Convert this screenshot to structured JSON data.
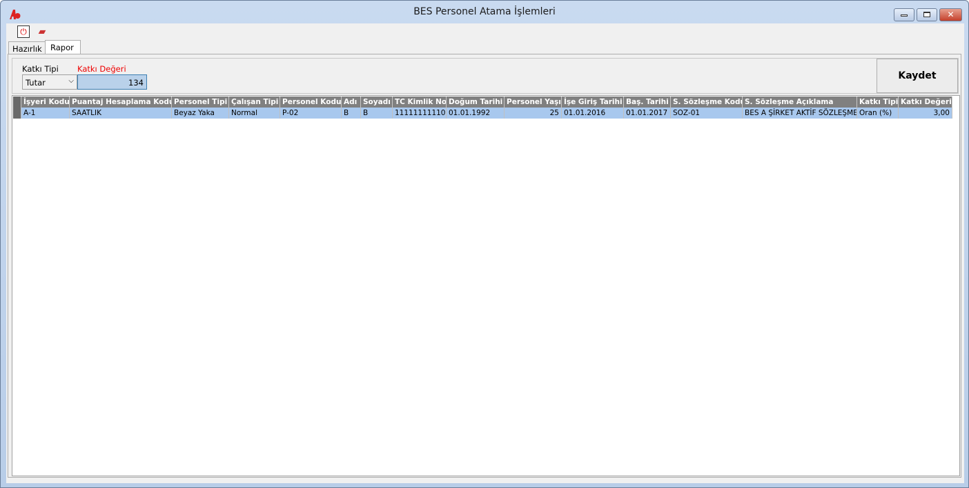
{
  "window": {
    "title": "BES Personel Atama İşlemleri",
    "accent": "#c4302b"
  },
  "toolbar": {
    "icons": [
      "power-icon",
      "eraser-icon"
    ]
  },
  "tabs": [
    {
      "label": "Hazırlık"
    },
    {
      "label": "Rapor"
    }
  ],
  "form": {
    "katki_tipi_label": "Katkı Tipi",
    "katki_tipi_value": "Tutar",
    "katki_degeri_label": "Katkı Değeri",
    "katki_degeri_value": "134",
    "save_label": "Kaydet"
  },
  "grid": {
    "columns": [
      "İşyeri Kodu",
      "Puantaj Hesaplama Kodu",
      "Personel Tipi",
      "Çalışan Tipi",
      "Personel Kodu",
      "Adı",
      "Soyadı",
      "TC Kimlik No",
      "Doğum Tarihi",
      "Personel Yaşı",
      "İşe Giriş Tarihi",
      "Baş. Tarihi",
      "S. Sözleşme Kodu",
      "S. Sözleşme Açıklama",
      "Katkı Tipi",
      "Katkı Değeri"
    ],
    "rows": [
      [
        "A-1",
        "SAATLIK",
        "Beyaz Yaka",
        "Normal",
        "P-02",
        "B",
        "B",
        "11111111110",
        "01.01.1992",
        "25",
        "01.01.2016",
        "01.01.2017",
        "SOZ-01",
        "BES A ŞİRKET AKTİF SÖZLEŞME",
        "Oran (%)",
        "3,00"
      ]
    ]
  }
}
